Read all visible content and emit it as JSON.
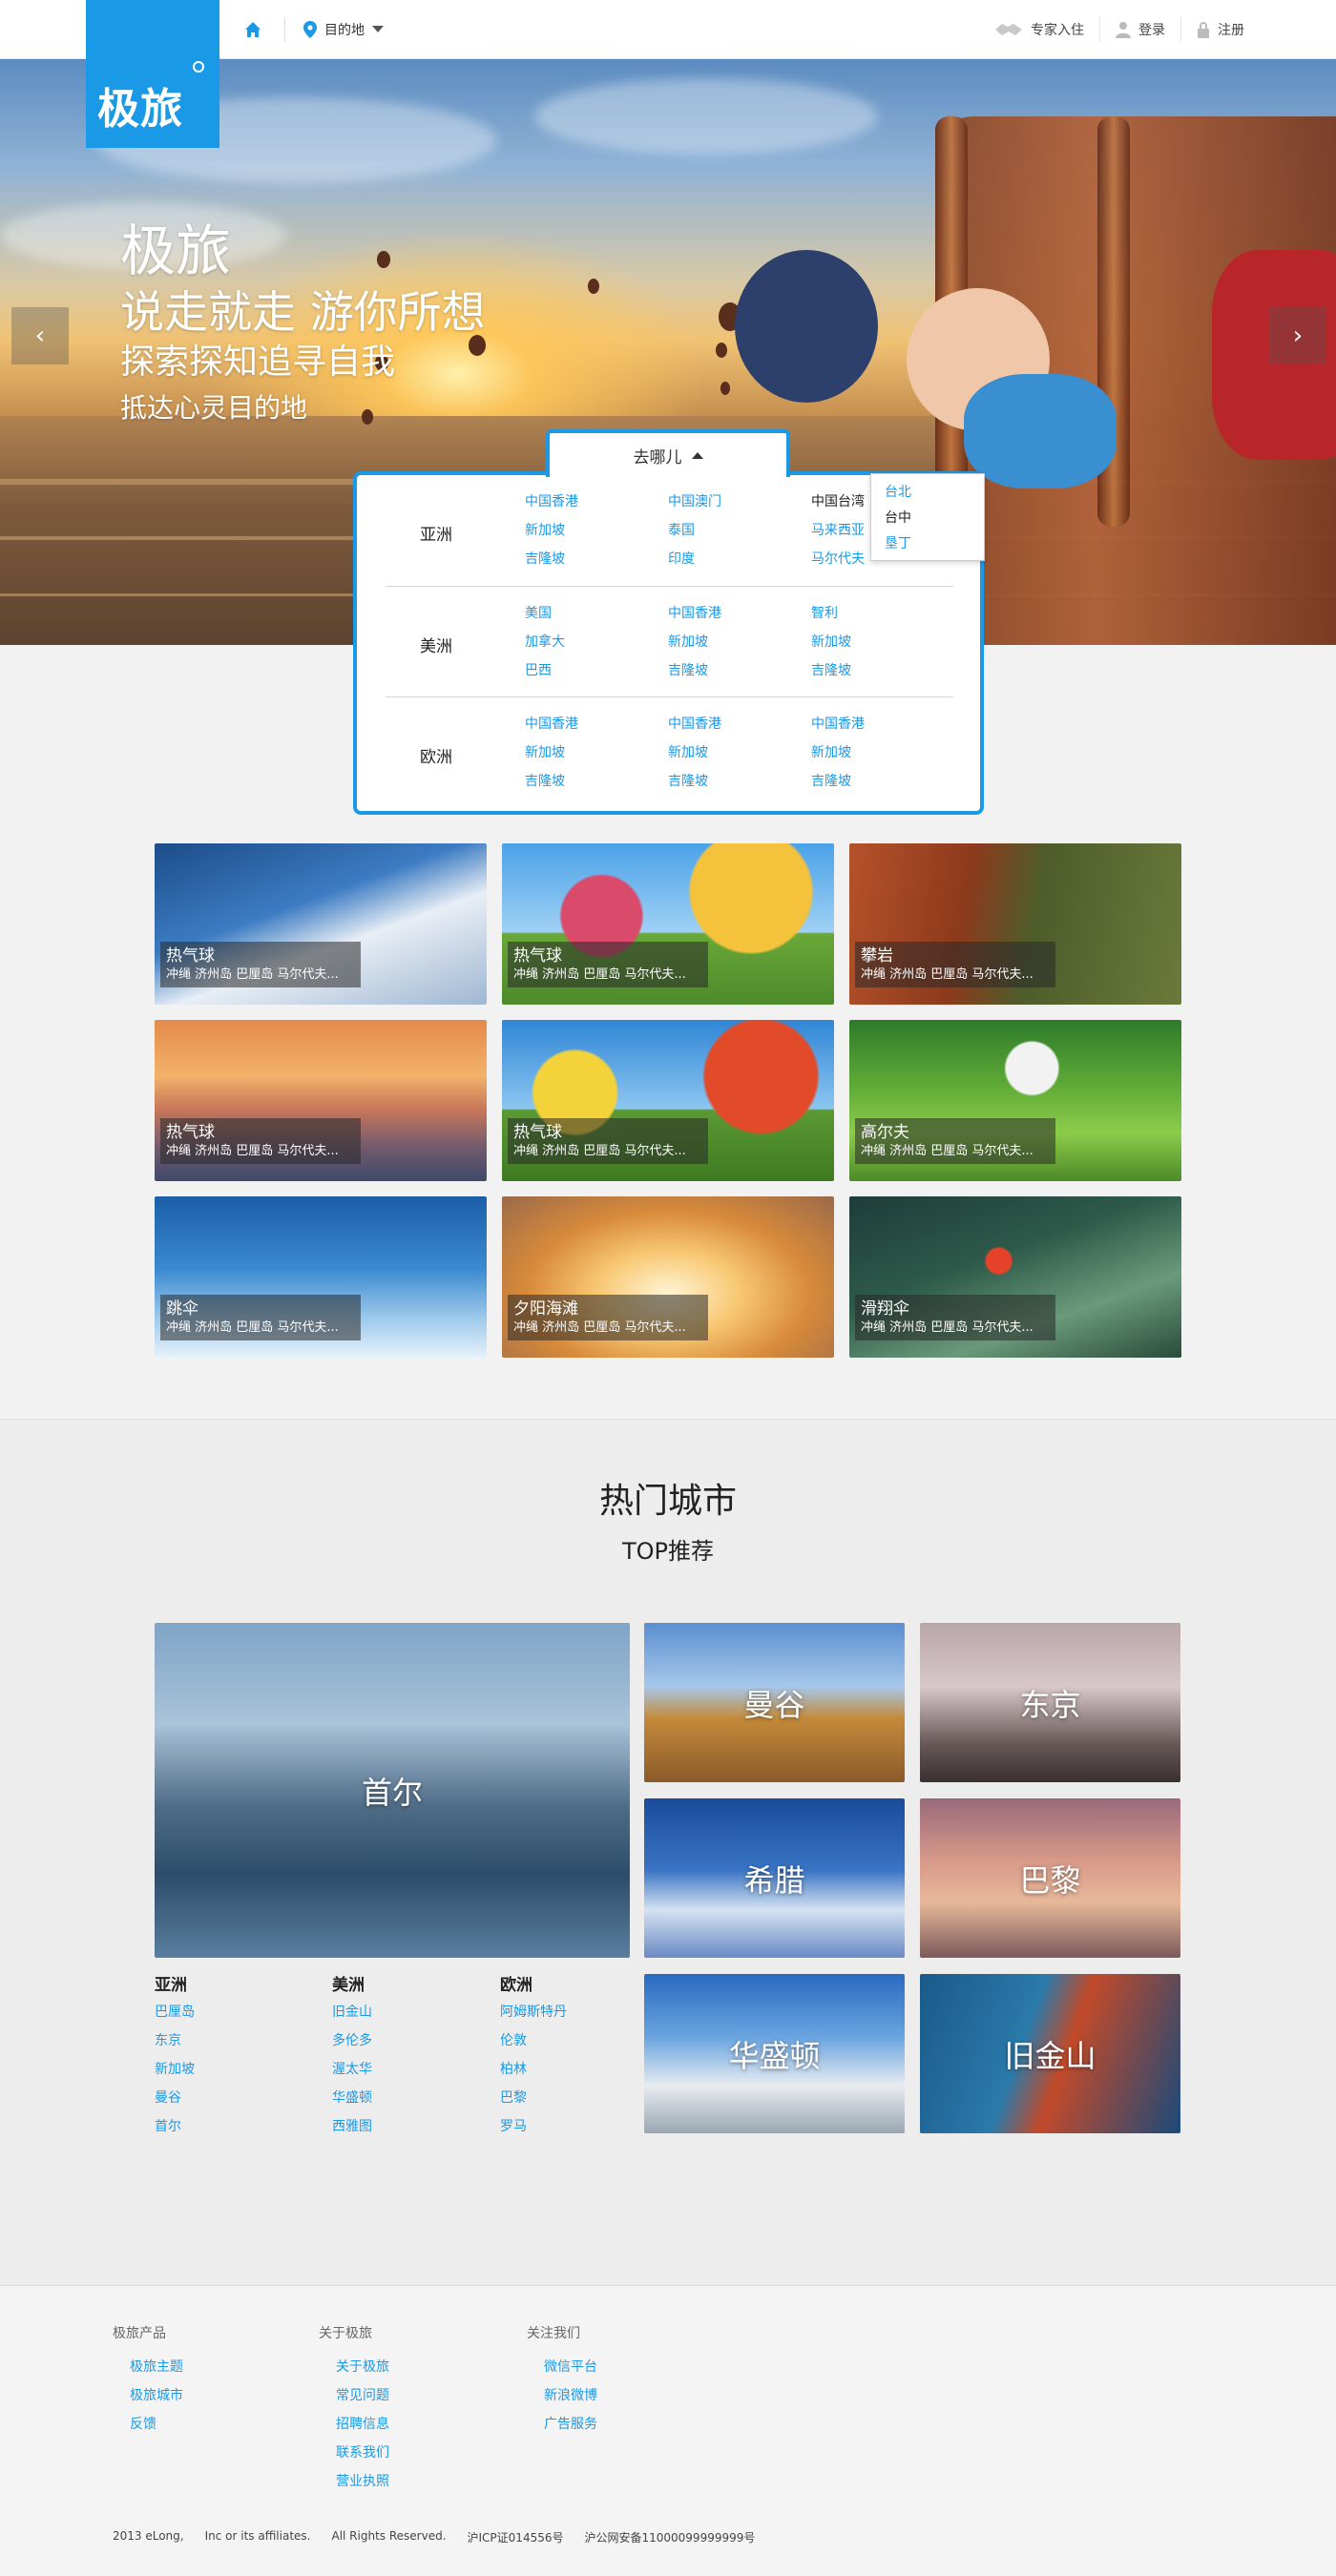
{
  "header": {
    "logo_text": "极旅",
    "destination_label": "目的地",
    "expert_label": "专家入住",
    "login_label": "登录",
    "register_label": "注册"
  },
  "hero": {
    "line1": "极旅",
    "line2": "说走就走 游你所想",
    "line3": "探索探知追寻自我",
    "line4": "抵达心灵目的地",
    "prev_icon": "‹",
    "next_icon": "›"
  },
  "destinations": {
    "tab_label": "去哪儿",
    "regions": [
      {
        "name": "亚洲",
        "items": [
          "中国香港",
          "中国澳门",
          "中国台湾",
          "新加坡",
          "泰国",
          "马来西亚",
          "吉隆坡",
          "印度",
          "马尔代夫"
        ]
      },
      {
        "name": "美洲",
        "items": [
          "美国",
          "中国香港",
          "智利",
          "加拿大",
          "新加坡",
          "新加坡",
          "巴西",
          "吉隆坡",
          "吉隆坡"
        ]
      },
      {
        "name": "欧洲",
        "items": [
          "中国香港",
          "中国香港",
          "中国香港",
          "新加坡",
          "新加坡",
          "新加坡",
          "吉隆坡",
          "吉隆坡",
          "吉隆坡"
        ]
      }
    ],
    "popup": [
      "台北",
      "台中",
      "垦丁"
    ]
  },
  "themes": [
    {
      "title": "热气球",
      "sub": "冲绳 济州岛 巴厘岛 马尔代夫..."
    },
    {
      "title": "热气球",
      "sub": "冲绳 济州岛 巴厘岛 马尔代夫..."
    },
    {
      "title": "攀岩",
      "sub": "冲绳 济州岛 巴厘岛 马尔代夫..."
    },
    {
      "title": "热气球",
      "sub": "冲绳 济州岛 巴厘岛 马尔代夫..."
    },
    {
      "title": "热气球",
      "sub": "冲绳 济州岛 巴厘岛 马尔代夫..."
    },
    {
      "title": "高尔夫",
      "sub": "冲绳 济州岛 巴厘岛 马尔代夫..."
    },
    {
      "title": "跳伞",
      "sub": "冲绳 济州岛 巴厘岛 马尔代夫..."
    },
    {
      "title": "夕阳海滩",
      "sub": "冲绳 济州岛 巴厘岛 马尔代夫..."
    },
    {
      "title": "滑翔伞",
      "sub": "冲绳 济州岛 巴厘岛 马尔代夫..."
    }
  ],
  "hot": {
    "title": "热门城市",
    "subtitle": "TOP推荐",
    "feature": "首尔",
    "tiles": [
      "曼谷",
      "东京",
      "希腊",
      "巴黎",
      "华盛顿",
      "旧金山"
    ],
    "columns": [
      {
        "name": "亚洲",
        "cities": [
          "巴厘岛",
          "东京",
          "新加坡",
          "曼谷",
          "首尔"
        ]
      },
      {
        "name": "美洲",
        "cities": [
          "旧金山",
          "多伦多",
          "渥太华",
          "华盛顿",
          "西雅图"
        ]
      },
      {
        "name": "欧洲",
        "cities": [
          "阿姆斯特丹",
          "伦敦",
          "柏林",
          "巴黎",
          "罗马"
        ]
      }
    ]
  },
  "footer": {
    "cols": [
      {
        "title": "极旅产品",
        "links": [
          "极旅主题",
          "极旅城市",
          "反馈"
        ]
      },
      {
        "title": "关于极旅",
        "links": [
          "关于极旅",
          "常见问题",
          "招聘信息",
          "联系我们",
          "营业执照"
        ]
      },
      {
        "title": "关注我们",
        "links": [
          "微信平台",
          "新浪微博",
          "广告服务"
        ]
      }
    ],
    "copyright": [
      "2013 eLong,",
      "Inc or its affiliates.",
      "All Rights Reserved.",
      "沪ICP证014556号",
      "沪公网安备11000099999999号"
    ]
  }
}
